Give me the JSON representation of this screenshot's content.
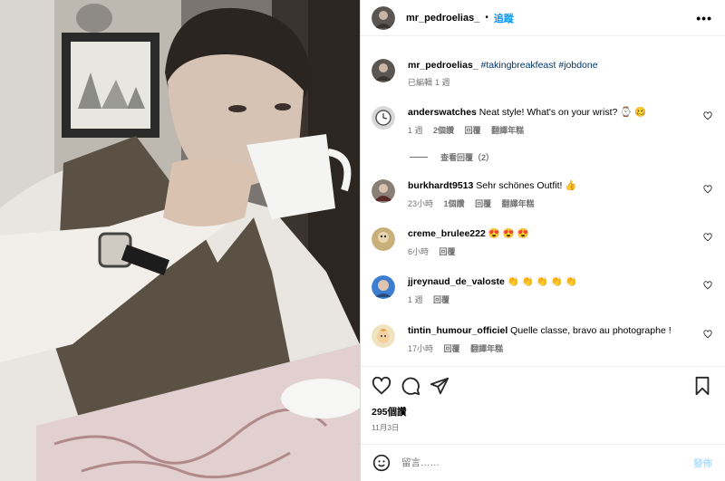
{
  "header": {
    "username": "mr_pedroelias_",
    "separator": "•",
    "follow_label": "追蹤",
    "more_label": "•••"
  },
  "caption": {
    "username": "mr_pedroelias_",
    "text": "#takingbreakfeast #jobdone",
    "edited": "已編輯",
    "time": "1 週"
  },
  "comments": [
    {
      "username": "anderswatches",
      "text": "Neat style! What's on your wrist? ⌚ 🥴",
      "time": "1 週",
      "likes": "2個讚",
      "reply": "回覆",
      "translate": "翻譯年糕",
      "view_replies": "查看回覆（2）"
    },
    {
      "username": "burkhardt9513",
      "text": "Sehr schönes Outfit! 👍",
      "time": "23小時",
      "likes": "1個讚",
      "reply": "回覆",
      "translate": "翻譯年糕"
    },
    {
      "username": "creme_brulee222",
      "text": "😍 😍 😍",
      "time": "6小時",
      "reply": "回覆"
    },
    {
      "username": "jjreynaud_de_valoste",
      "text": "👏 👏 👏 👏 👏",
      "time": "1 週",
      "reply": "回覆"
    },
    {
      "username": "tintin_humour_officiel",
      "text": "Quelle classe, bravo au photographe !",
      "time": "17小時",
      "reply": "回覆",
      "translate": "翻譯年糕"
    }
  ],
  "post": {
    "likes": "295個讚",
    "date": "11月3日"
  },
  "composer": {
    "placeholder": "留言……",
    "post_label": "發佈"
  },
  "colors": {
    "link": "#0095f6",
    "hashtag": "#00376b",
    "muted": "#737373"
  }
}
